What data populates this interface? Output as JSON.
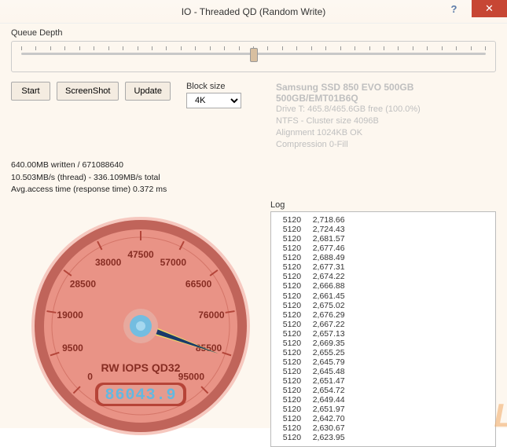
{
  "window": {
    "title": "IO - Threaded QD (Random Write)",
    "help": "?",
    "close": "✕"
  },
  "queue": {
    "label": "Queue Depth"
  },
  "buttons": {
    "start": "Start",
    "screenshot": "ScreenShot",
    "update": "Update"
  },
  "block_size": {
    "label": "Block size",
    "value": "4K"
  },
  "drive": {
    "title": "Samsung SSD 850 EVO 500GB 500GB/EMT01B6Q",
    "line1": "Drive T: 465.8/465.6GB free (100.0%)",
    "line2": "NTFS - Cluster size 4096B",
    "line3": "Alignment 1024KB OK",
    "line4": "Compression 0-Fill"
  },
  "stats": {
    "line1": "640.00MB written / 671088640",
    "line2": "10.503MB/s (thread) - 336.109MB/s total",
    "line3": "Avg.access time (response time) 0.372 ms"
  },
  "log_label": "Log",
  "log_rows": [
    [
      5120,
      "2,718.66"
    ],
    [
      5120,
      "2,724.43"
    ],
    [
      5120,
      "2,681.57"
    ],
    [
      5120,
      "2,677.46"
    ],
    [
      5120,
      "2,688.49"
    ],
    [
      5120,
      "2,677.31"
    ],
    [
      5120,
      "2,674.22"
    ],
    [
      5120,
      "2,666.88"
    ],
    [
      5120,
      "2,661.45"
    ],
    [
      5120,
      "2,675.02"
    ],
    [
      5120,
      "2,676.29"
    ],
    [
      5120,
      "2,667.22"
    ],
    [
      5120,
      "2,657.13"
    ],
    [
      5120,
      "2,669.35"
    ],
    [
      5120,
      "2,655.25"
    ],
    [
      5120,
      "2,645.79"
    ],
    [
      5120,
      "2,645.48"
    ],
    [
      5120,
      "2,651.47"
    ],
    [
      5120,
      "2,654.72"
    ],
    [
      5120,
      "2,649.44"
    ],
    [
      5120,
      "2,651.97"
    ],
    [
      5120,
      "2,642.70"
    ],
    [
      5120,
      "2,630.67"
    ],
    [
      5120,
      "2,623.95"
    ]
  ],
  "watermark": "L",
  "chart_data": {
    "type": "gauge",
    "label": "RW IOPS QD32",
    "display_value": "86043.9",
    "needle_value": 86043.9,
    "min": 0,
    "max": 95000,
    "ticks": [
      0,
      9500,
      19000,
      28500,
      38000,
      47500,
      57000,
      66500,
      76000,
      85500,
      95000
    ],
    "start_angle": -225,
    "end_angle": 45,
    "color_face": "#e99386",
    "color_rim": "#c0645a",
    "color_accent": "#63b8e0"
  }
}
